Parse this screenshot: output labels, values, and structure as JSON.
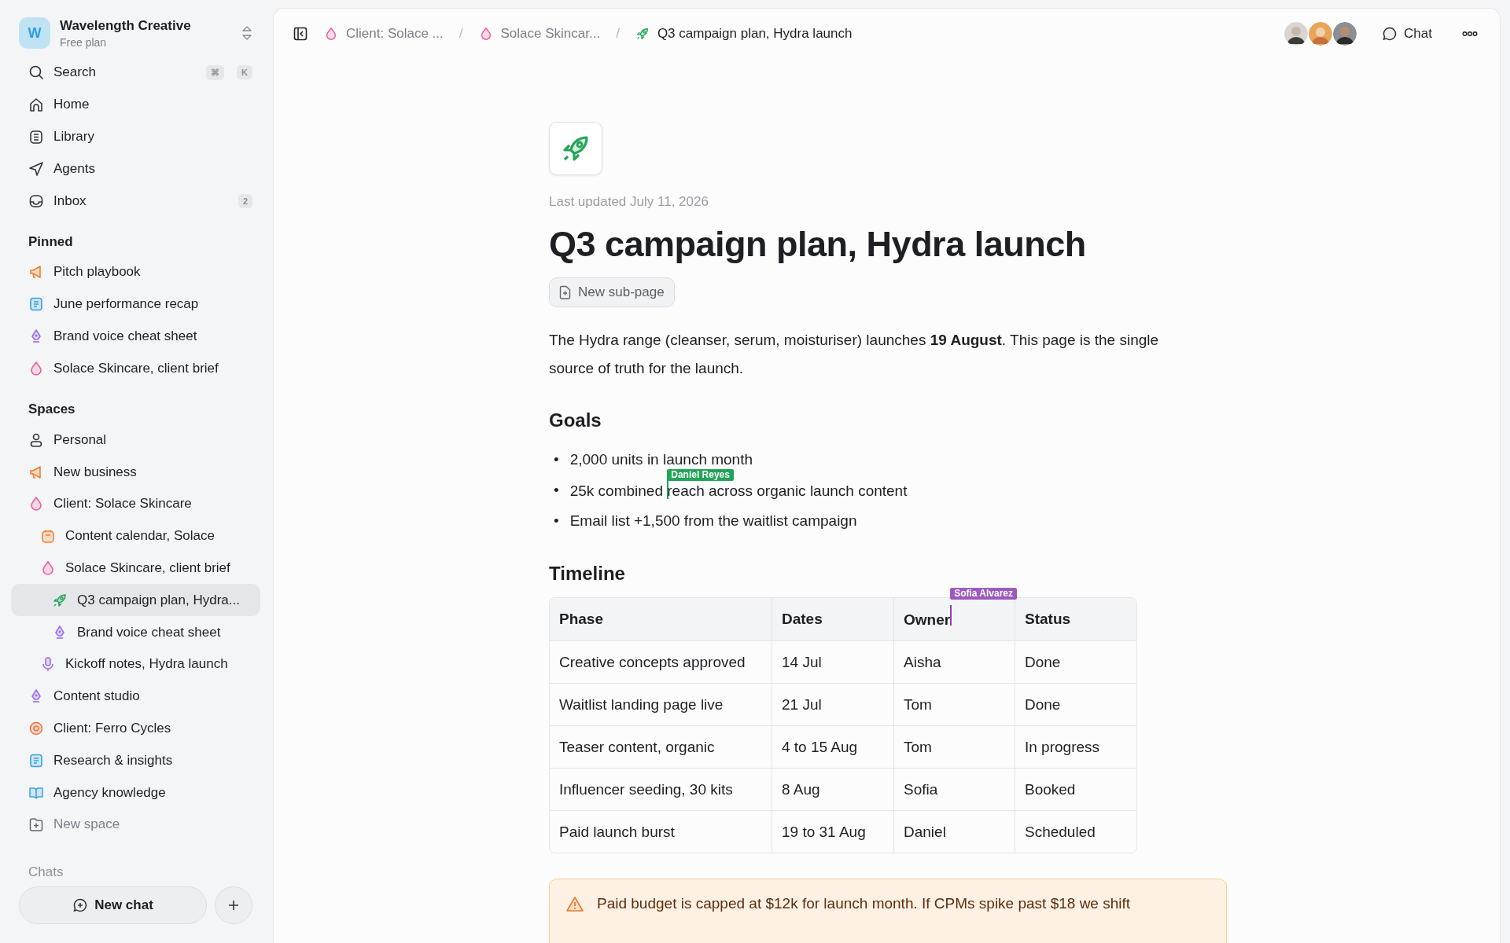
{
  "workspace": {
    "initial": "W",
    "name": "Wavelength Creative",
    "plan": "Free plan"
  },
  "nav": [
    {
      "kind": "search",
      "label": "Search",
      "shortcut": [
        "⌘",
        "K"
      ]
    },
    {
      "kind": "home",
      "label": "Home"
    },
    {
      "kind": "library",
      "label": "Library"
    },
    {
      "kind": "agents",
      "label": "Agents"
    },
    {
      "kind": "inbox",
      "label": "Inbox",
      "badge": "2"
    }
  ],
  "pinned": {
    "title": "Pinned",
    "items": [
      {
        "kind": "megaphone",
        "label": "Pitch playbook"
      },
      {
        "kind": "doc",
        "label": "June performance recap"
      },
      {
        "kind": "pen",
        "label": "Brand voice cheat sheet"
      },
      {
        "kind": "drop",
        "label": "Solace Skincare, client brief"
      }
    ]
  },
  "spaces": {
    "title": "Spaces",
    "items": [
      {
        "kind": "person",
        "label": "Personal",
        "selected": false,
        "muted": false
      },
      {
        "kind": "megaphone",
        "label": "New business",
        "selected": false,
        "muted": false
      },
      {
        "kind": "drop",
        "label": "Client: Solace Skincare",
        "selected": false,
        "muted": false,
        "children": [
          {
            "kind": "calendar",
            "label": "Content calendar, Solace",
            "selected": false,
            "muted": false
          },
          {
            "kind": "drop",
            "label": "Solace Skincare, client brief",
            "selected": false,
            "muted": false,
            "children": [
              {
                "kind": "rocket",
                "label": "Q3 campaign plan, Hydra...",
                "selected": true,
                "muted": false
              },
              {
                "kind": "pen",
                "label": "Brand voice cheat sheet",
                "selected": false,
                "muted": false
              }
            ]
          },
          {
            "kind": "mic",
            "label": "Kickoff notes, Hydra launch",
            "selected": false,
            "muted": false
          }
        ]
      },
      {
        "kind": "pen",
        "label": "Content studio",
        "selected": false,
        "muted": false
      },
      {
        "kind": "target",
        "label": "Client: Ferro Cycles",
        "selected": false,
        "muted": false
      },
      {
        "kind": "doc",
        "label": "Research & insights",
        "selected": false,
        "muted": false
      },
      {
        "kind": "book",
        "label": "Agency knowledge",
        "selected": false,
        "muted": false
      },
      {
        "kind": "folder-plus",
        "label": "New space",
        "selected": false,
        "muted": true
      }
    ]
  },
  "chats": {
    "title": "Chats"
  },
  "new_chat": "New chat",
  "breadcrumbs": [
    {
      "kind": "drop",
      "label": "Client: Solace ...",
      "current": false
    },
    {
      "separator": "/",
      "kind": "drop",
      "label": "Solace Skincar...",
      "current": false
    },
    {
      "separator": "/",
      "kind": "rocket",
      "label": "Q3 campaign plan, Hydra launch",
      "current": true
    }
  ],
  "chat_button": "Chat",
  "page": {
    "last_updated": "Last updated July 11, 2026",
    "title": "Q3 campaign plan, Hydra launch",
    "new_subpage": "New sub-page",
    "intro": "The Hydra range (cleanser, serum, moisturiser) launches **19 August**. This page is the single source of truth for the launch.",
    "goals_heading": "Goals",
    "goals": [
      {
        "bullet": "•",
        "parts": [
          "2,000 units in launch month"
        ]
      },
      {
        "bullet": "•",
        "parts": [
          "25k combined ",
          "reach across organic launch content"
        ],
        "cursor": {
          "name": "Daniel Reyes",
          "color": "#22a559"
        }
      },
      {
        "bullet": "•",
        "parts": [
          "Email list +1,500 from the waitlist campaign"
        ]
      }
    ],
    "timeline_heading": "Timeline",
    "table": {
      "columns": [
        {
          "label": "Phase"
        },
        {
          "label": "Dates"
        },
        {
          "label": "Owner",
          "cursor": {
            "name": "Sofia Alvarez",
            "color": "#8e3fb5"
          }
        },
        {
          "label": "Status"
        }
      ],
      "rows": [
        [
          "Creative concepts approved",
          "14 Jul",
          "Aisha",
          "Done"
        ],
        [
          "Waitlist landing page live",
          "21 Jul",
          "Tom",
          "Done"
        ],
        [
          "Teaser content, organic",
          "4 to 15 Aug",
          "Tom",
          "In progress"
        ],
        [
          "Influencer seeding, 30 kits",
          "8 Aug",
          "Sofia",
          "Booked"
        ],
        [
          "Paid launch burst",
          "19 to 31 Aug",
          "Daniel",
          "Scheduled"
        ]
      ]
    },
    "callout": {
      "kind": "warning",
      "text": "Paid budget is capped at $12k for launch month. If CPMs spike past $18 we shift"
    }
  }
}
